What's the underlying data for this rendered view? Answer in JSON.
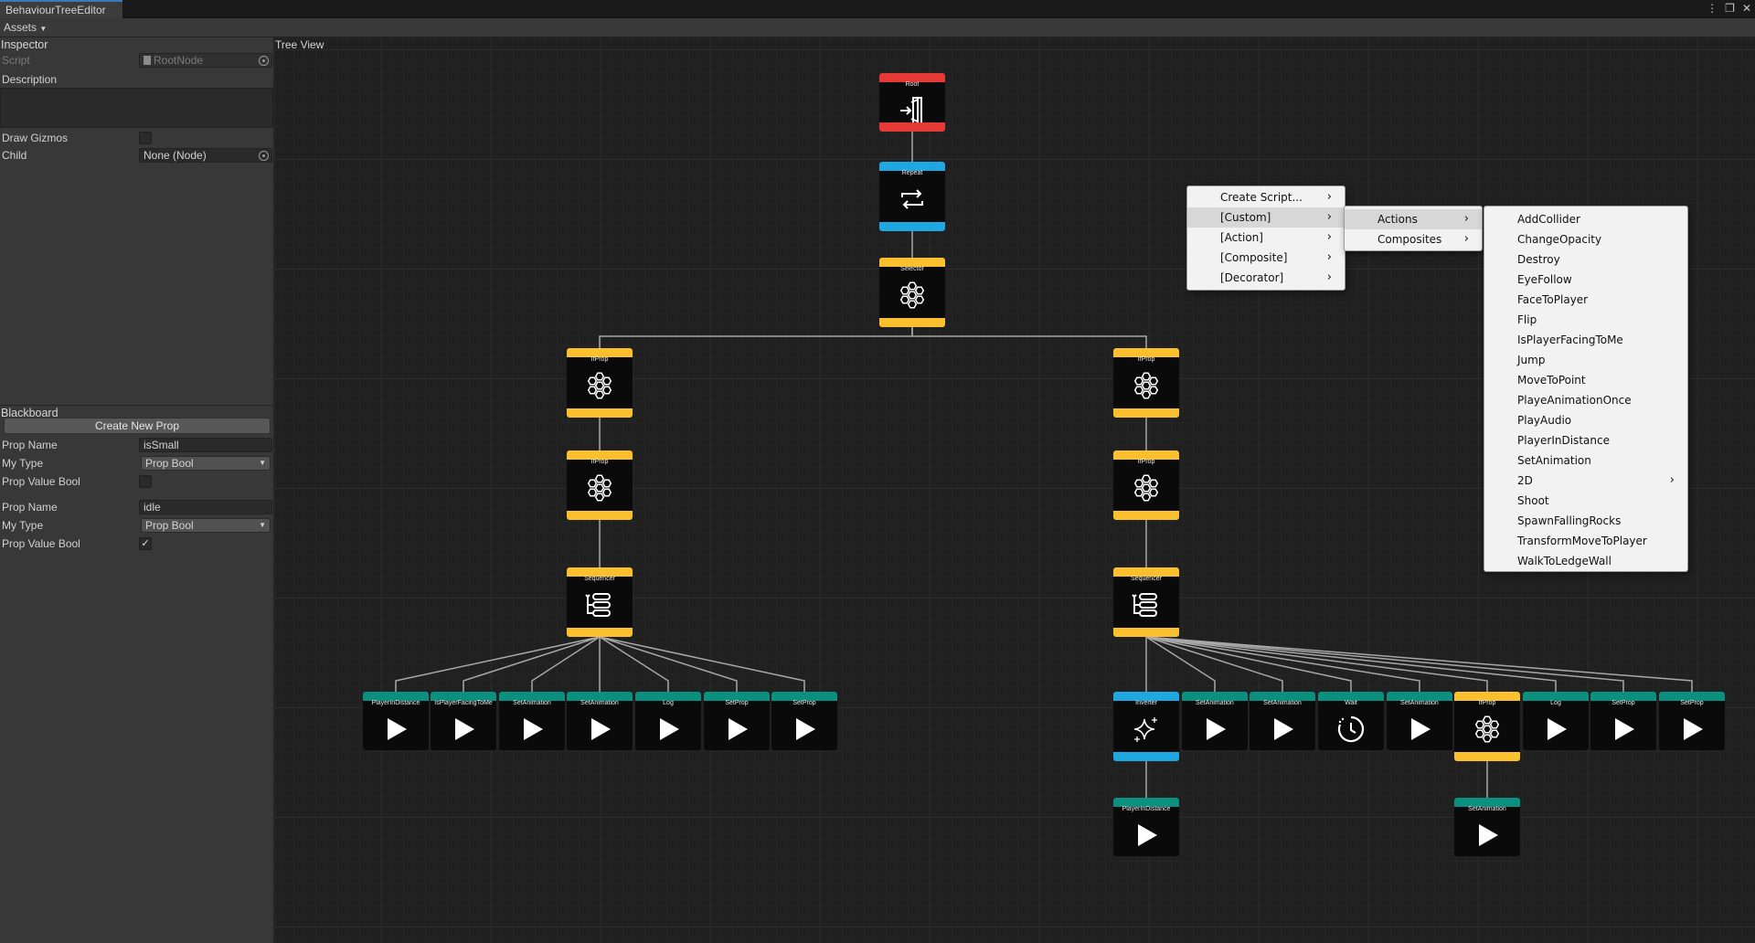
{
  "window": {
    "tab_title": "BehaviourTreeEditor"
  },
  "toolbar": {
    "assets_label": "Assets"
  },
  "inspector": {
    "title": "Inspector",
    "script_label": "Script",
    "script_value": "RootNode",
    "description_label": "Description",
    "draw_gizmos_label": "Draw Gizmos",
    "child_label": "Child",
    "child_value": "None (Node)"
  },
  "blackboard": {
    "title": "Blackboard",
    "create_button": "Create New Prop",
    "props": [
      {
        "name_label": "Prop Name",
        "name_value": "isSmall",
        "type_label": "My Type",
        "type_value": "Prop Bool",
        "value_label": "Prop Value Bool",
        "checked": false
      },
      {
        "name_label": "Prop Name",
        "name_value": "idle",
        "type_label": "My Type",
        "type_value": "Prop Bool",
        "value_label": "Prop Value Bool",
        "checked": true
      }
    ]
  },
  "tree_view": {
    "title": "Tree View",
    "colors": {
      "root": "#e53935",
      "decorator": "#1ea7e1",
      "composite": "#fbc02d",
      "action": "#0b8f7f",
      "edge": "#a8a8a8"
    },
    "nodes": [
      {
        "id": "root",
        "title": "Root",
        "kind": "root",
        "icon": "enter-door-icon"
      },
      {
        "id": "repeat",
        "title": "Repeat",
        "kind": "decorator",
        "icon": "repeat-icon"
      },
      {
        "id": "selector",
        "title": "Selector",
        "kind": "composite",
        "icon": "hexagon-cluster-icon"
      },
      {
        "id": "ifprop-l1",
        "title": "IfProp",
        "kind": "composite",
        "icon": "hexagon-cluster-icon"
      },
      {
        "id": "ifprop-l2",
        "title": "IfProp",
        "kind": "composite",
        "icon": "hexagon-cluster-icon"
      },
      {
        "id": "sequencer-l",
        "title": "Sequencer",
        "kind": "composite",
        "icon": "sequence-stack-icon"
      },
      {
        "id": "ifprop-r1",
        "title": "IfProp",
        "kind": "composite",
        "icon": "hexagon-cluster-icon"
      },
      {
        "id": "ifprop-r2",
        "title": "IfProp",
        "kind": "composite",
        "icon": "hexagon-cluster-icon"
      },
      {
        "id": "sequencer-r",
        "title": "Sequencer",
        "kind": "composite",
        "icon": "sequence-stack-icon"
      },
      {
        "id": "l-a1",
        "title": "PlayerInDistance",
        "kind": "action",
        "icon": "play-icon"
      },
      {
        "id": "l-a2",
        "title": "IsPlayerFacingToMe",
        "kind": "action",
        "icon": "play-icon"
      },
      {
        "id": "l-a3",
        "title": "SetAnimation",
        "kind": "action",
        "icon": "play-icon"
      },
      {
        "id": "l-a4",
        "title": "SetAnimation",
        "kind": "action",
        "icon": "play-icon"
      },
      {
        "id": "l-a5",
        "title": "Log",
        "kind": "action",
        "icon": "play-icon"
      },
      {
        "id": "l-a6",
        "title": "SetProp",
        "kind": "action",
        "icon": "play-icon"
      },
      {
        "id": "l-a7",
        "title": "SetProp",
        "kind": "action",
        "icon": "play-icon"
      },
      {
        "id": "r-inverter",
        "title": "Inverter",
        "kind": "decorator",
        "icon": "sparkle-icon"
      },
      {
        "id": "r-a2",
        "title": "SetAnimation",
        "kind": "action",
        "icon": "play-icon"
      },
      {
        "id": "r-a3",
        "title": "SetAnimation",
        "kind": "action",
        "icon": "play-icon"
      },
      {
        "id": "r-wait",
        "title": "Wait",
        "kind": "action",
        "icon": "timer-icon"
      },
      {
        "id": "r-a5",
        "title": "SetAnimation",
        "kind": "action",
        "icon": "play-icon"
      },
      {
        "id": "r-ifprop",
        "title": "IfProp",
        "kind": "composite",
        "icon": "hexagon-cluster-icon"
      },
      {
        "id": "r-a7",
        "title": "Log",
        "kind": "action",
        "icon": "play-icon"
      },
      {
        "id": "r-a8",
        "title": "SetProp",
        "kind": "action",
        "icon": "play-icon"
      },
      {
        "id": "r-a9",
        "title": "SetProp",
        "kind": "action",
        "icon": "play-icon"
      },
      {
        "id": "r-sub1",
        "title": "PlayerInDistance",
        "kind": "action",
        "icon": "play-icon"
      },
      {
        "id": "r-sub2",
        "title": "SetAnimation",
        "kind": "action",
        "icon": "play-icon"
      }
    ],
    "edges": [
      [
        "root",
        "repeat"
      ],
      [
        "repeat",
        "selector"
      ],
      [
        "selector",
        "ifprop-l1"
      ],
      [
        "selector",
        "ifprop-r1"
      ],
      [
        "ifprop-l1",
        "ifprop-l2"
      ],
      [
        "ifprop-l2",
        "sequencer-l"
      ],
      [
        "ifprop-r1",
        "ifprop-r2"
      ],
      [
        "ifprop-r2",
        "sequencer-r"
      ],
      [
        "sequencer-l",
        "l-a1"
      ],
      [
        "sequencer-l",
        "l-a2"
      ],
      [
        "sequencer-l",
        "l-a3"
      ],
      [
        "sequencer-l",
        "l-a4"
      ],
      [
        "sequencer-l",
        "l-a5"
      ],
      [
        "sequencer-l",
        "l-a6"
      ],
      [
        "sequencer-l",
        "l-a7"
      ],
      [
        "sequencer-r",
        "r-inverter"
      ],
      [
        "sequencer-r",
        "r-a2"
      ],
      [
        "sequencer-r",
        "r-a3"
      ],
      [
        "sequencer-r",
        "r-wait"
      ],
      [
        "sequencer-r",
        "r-a5"
      ],
      [
        "sequencer-r",
        "r-ifprop"
      ],
      [
        "sequencer-r",
        "r-a7"
      ],
      [
        "sequencer-r",
        "r-a8"
      ],
      [
        "sequencer-r",
        "r-a9"
      ],
      [
        "r-inverter",
        "r-sub1"
      ],
      [
        "r-ifprop",
        "r-sub2"
      ]
    ]
  },
  "context_menu": {
    "level1": [
      {
        "label": "Create Script...",
        "submenu": true
      },
      {
        "label": "[Custom]",
        "submenu": true,
        "highlighted": true
      },
      {
        "label": "[Action]",
        "submenu": true
      },
      {
        "label": "[Composite]",
        "submenu": true
      },
      {
        "label": "[Decorator]",
        "submenu": true
      }
    ],
    "level2": [
      {
        "label": "Actions",
        "submenu": true,
        "highlighted": true
      },
      {
        "label": "Composites",
        "submenu": true
      }
    ],
    "level3": [
      {
        "label": "AddCollider"
      },
      {
        "label": "ChangeOpacity"
      },
      {
        "label": "Destroy"
      },
      {
        "label": "EyeFollow"
      },
      {
        "label": "FaceToPlayer"
      },
      {
        "label": "Flip"
      },
      {
        "label": "IsPlayerFacingToMe"
      },
      {
        "label": "Jump"
      },
      {
        "label": "MoveToPoint"
      },
      {
        "label": "PlayeAnimationOnce"
      },
      {
        "label": "PlayAudio"
      },
      {
        "label": "PlayerInDistance"
      },
      {
        "label": "SetAnimation"
      },
      {
        "label": "2D",
        "submenu": true
      },
      {
        "label": "Shoot"
      },
      {
        "label": "SpawnFallingRocks"
      },
      {
        "label": "TransformMoveToPlayer"
      },
      {
        "label": "WalkToLedgeWall"
      }
    ]
  }
}
